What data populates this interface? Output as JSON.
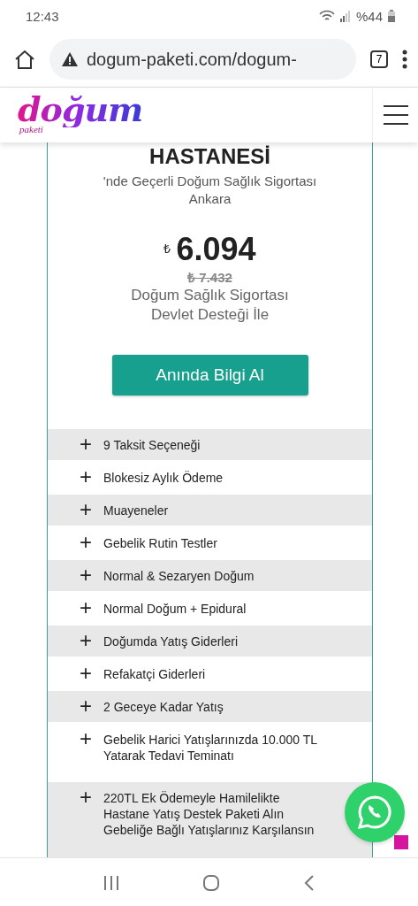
{
  "status_bar": {
    "time": "12:43",
    "battery": "%44"
  },
  "browser": {
    "url": "dogum-paketi.com/dogum-",
    "tab_count": "7"
  },
  "header": {
    "logo": "doğum",
    "logo_sub": "paketi"
  },
  "card": {
    "title": "HASTANESİ",
    "subtitle": "'nde Geçerli Doğum Sağlık Sigortası",
    "city": "Ankara",
    "currency": "₺",
    "price": "6.094",
    "old_price": "₺ 7.432",
    "note_1": "Doğum Sağlık Sigortası",
    "note_2": "Devlet Desteği İle",
    "button": "Anında Bilgi Al"
  },
  "features": [
    {
      "icon": "+",
      "label": "9 Taksit Seçeneği"
    },
    {
      "icon": "+",
      "label": "Blokesiz Aylık Ödeme"
    },
    {
      "icon": "+",
      "label": "Muayeneler"
    },
    {
      "icon": "+",
      "label": "Gebelik Rutin Testler"
    },
    {
      "icon": "+",
      "label": "Normal & Sezaryen Doğum"
    },
    {
      "icon": "+",
      "label": "Normal Doğum + Epidural"
    },
    {
      "icon": "+",
      "label": "Doğumda Yatış Giderleri"
    },
    {
      "icon": "+",
      "label": "Refakatçi Giderleri"
    },
    {
      "icon": "+",
      "label": "2 Geceye Kadar Yatış"
    },
    {
      "icon": "+",
      "label": "Gebelik Harici Yatışlarınızda 10.000 TL Yatarak Tedavi Teminatı"
    },
    {
      "icon": "+",
      "label": "220TL Ek Ödemeyle Hamilelikte Hastane Yatış Destek Paketi Alın Gebeliğe Bağlı Yatışlarınız Karşılansın"
    }
  ]
}
